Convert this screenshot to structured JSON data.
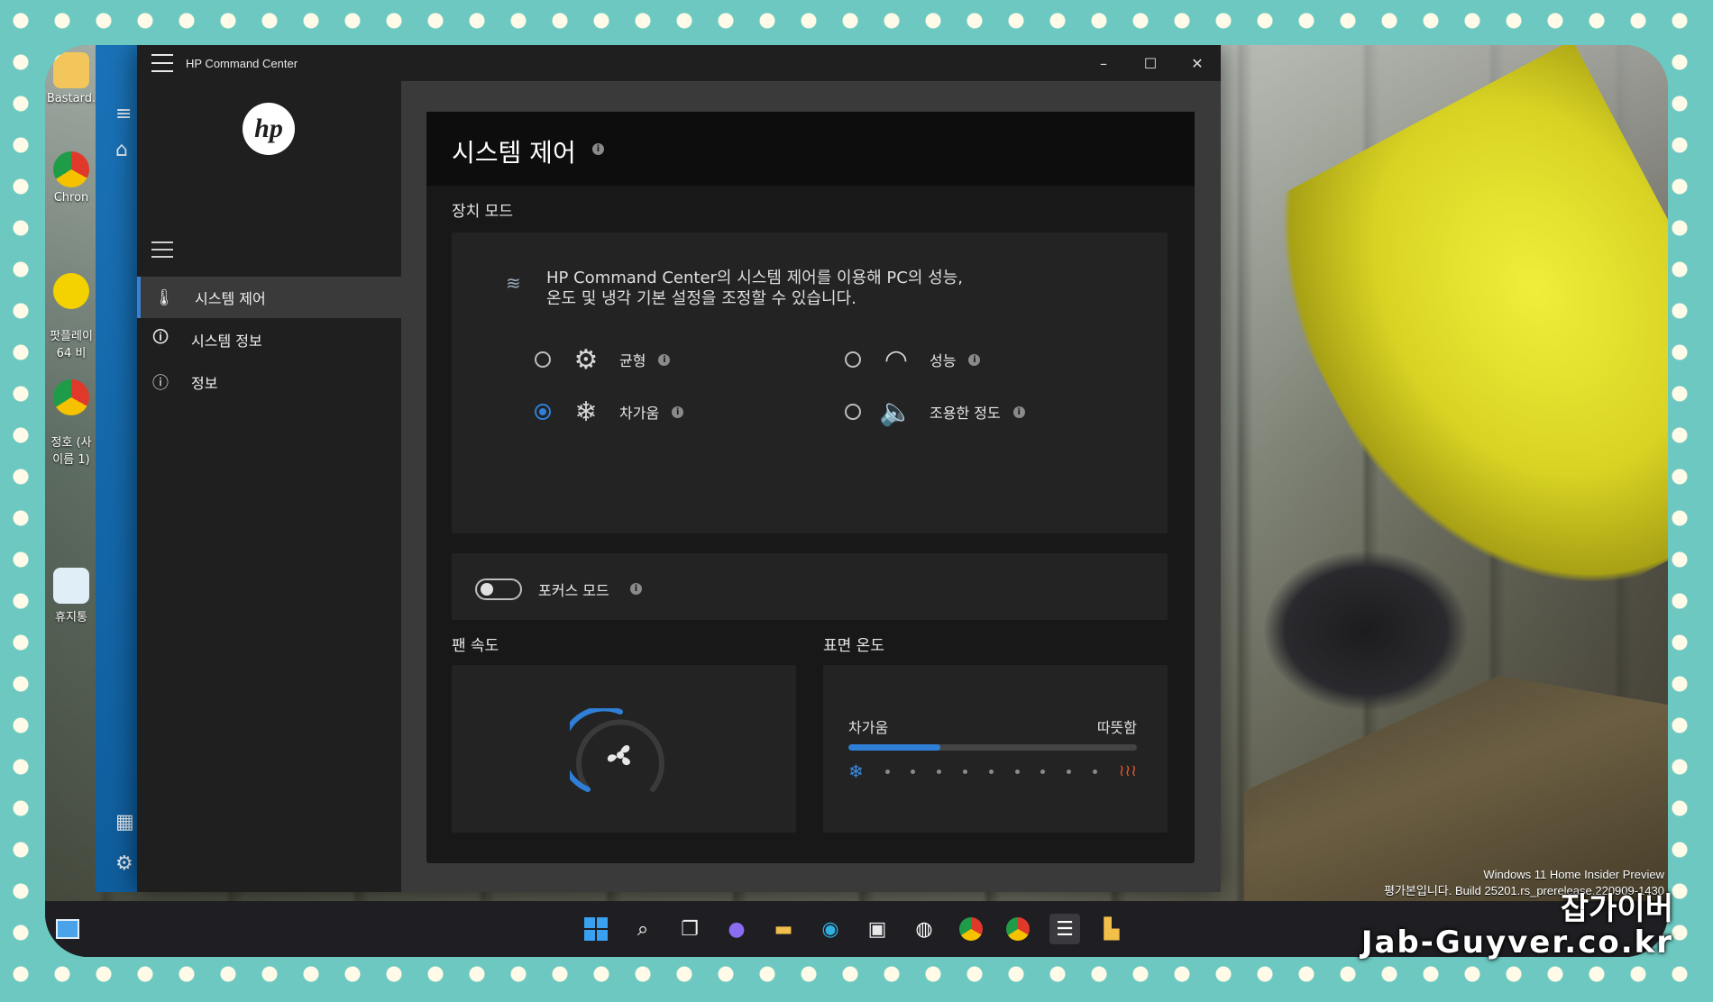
{
  "window": {
    "title": "HP Command Center",
    "minimize": "–",
    "maximize": "☐",
    "close": "✕"
  },
  "brand": {
    "logo_text": "hp"
  },
  "nav": {
    "items": [
      {
        "label": "시스템 제어",
        "icon": "thermometer-icon"
      },
      {
        "label": "시스템 정보",
        "icon": "info-box-icon"
      },
      {
        "label": "정보",
        "icon": "info-circle-icon"
      }
    ]
  },
  "panel": {
    "title": "시스템 제어",
    "device_mode_label": "장치 모드",
    "device_mode_desc": "HP Command Center의 시스템 제어를 이용해 PC의 성능, 온도 및 냉각 기본 설정을 조정할 수 있습니다.",
    "modes": [
      {
        "label": "균형",
        "icon": "gear-balance-icon",
        "selected": false
      },
      {
        "label": "성능",
        "icon": "speedometer-icon",
        "selected": false
      },
      {
        "label": "차가움",
        "icon": "snowflake-icon",
        "selected": true
      },
      {
        "label": "조용한 정도",
        "icon": "speaker-quiet-icon",
        "selected": false
      }
    ],
    "focus_mode_label": "포커스 모드",
    "focus_mode_on": false,
    "fan_speed_label": "팬 속도",
    "surface_temp_label": "표면 온도",
    "temp_cold": "차가움",
    "temp_warm": "따뜻함",
    "temp_level": 0.32
  },
  "desktop": {
    "icons": [
      "Bastard.",
      "Chron",
      "팟플레이\n64 비",
      "정호 (사\n이름 1)",
      "휴지통"
    ]
  },
  "watermark": {
    "os_line": "Windows 11 Home Insider Preview",
    "build_line": "평가본입니다. Build 25201.rs_prerelease.220909-1430",
    "brand_ko": "잡가이버",
    "brand_en": "Jab-Guyver.co.kr"
  },
  "colors": {
    "accent": "#2f7fd6",
    "heat": "#e0562c"
  }
}
